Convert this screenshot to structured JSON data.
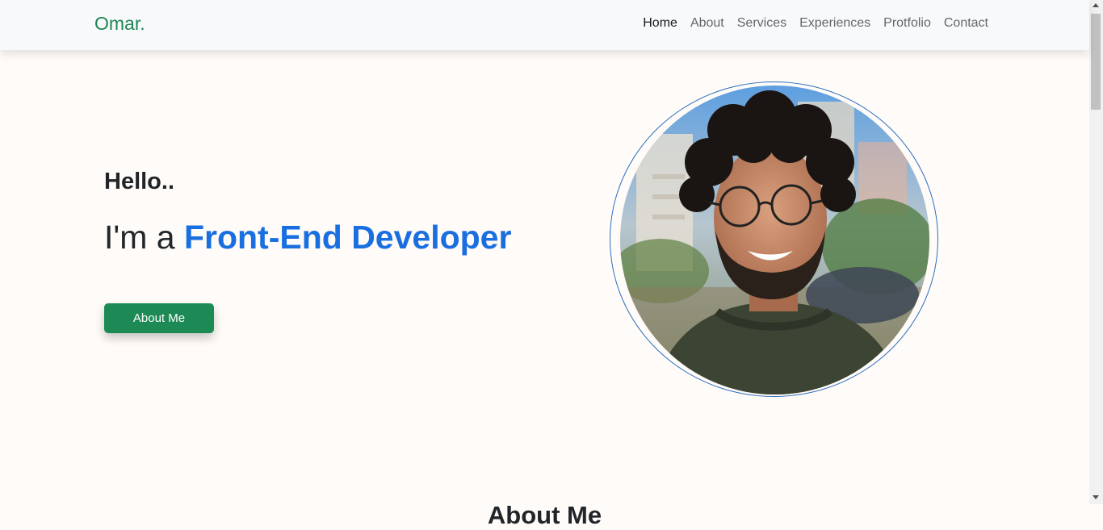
{
  "brand": "Omar.",
  "nav": {
    "items": [
      "Home",
      "About",
      "Services",
      "Experiences",
      "Protfolio",
      "Contact"
    ],
    "active": "Home"
  },
  "hero": {
    "greeting": "Hello..",
    "intro": "I'm a ",
    "role": "Front-End Developer",
    "button_label": "About Me"
  },
  "portrait": {
    "icon": "profile-photo"
  },
  "next_section": {
    "title": "About Me"
  },
  "colors": {
    "brand": "#1e8555",
    "accent": "#1a6fe0",
    "button": "#1d8a55",
    "background": "#fffbf8"
  }
}
